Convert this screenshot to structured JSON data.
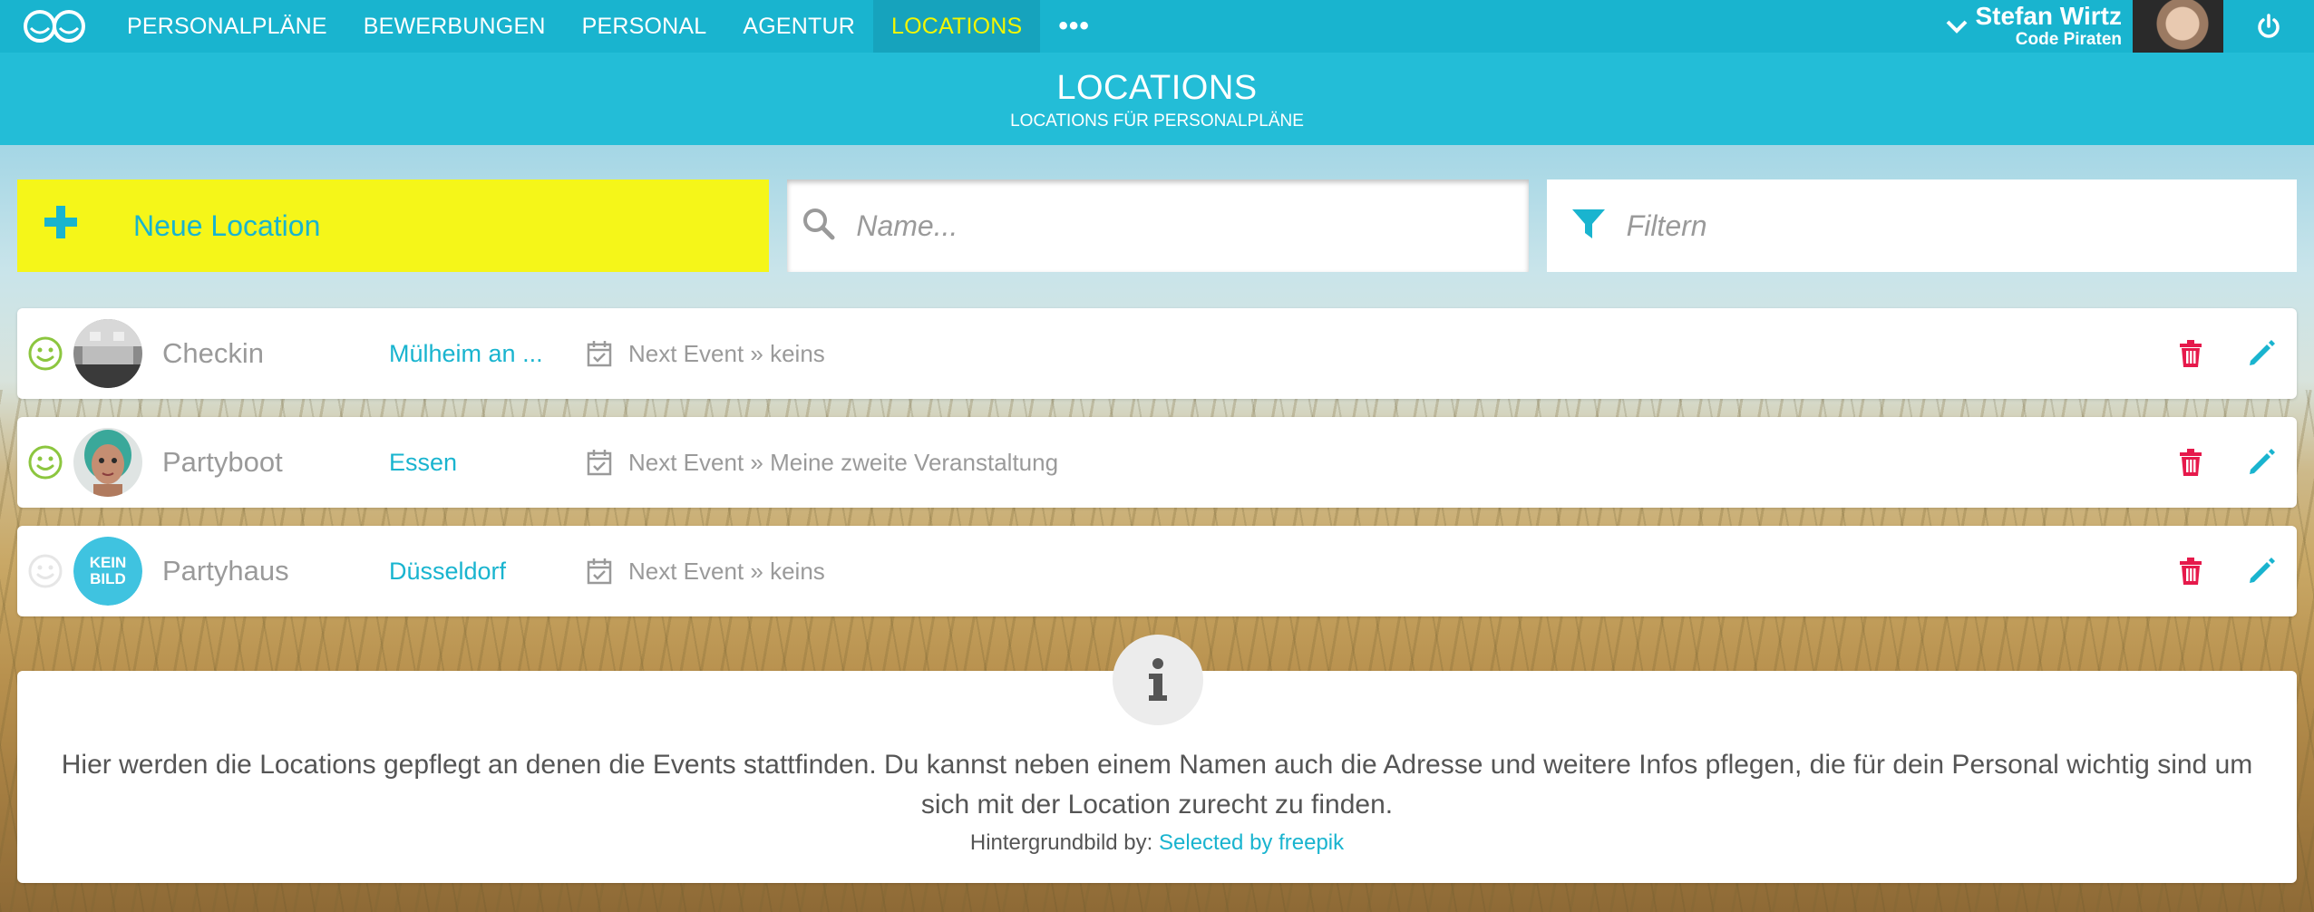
{
  "nav": {
    "items": [
      {
        "label": "PERSONALPLÄNE"
      },
      {
        "label": "BEWERBUNGEN"
      },
      {
        "label": "PERSONAL"
      },
      {
        "label": "AGENTUR"
      },
      {
        "label": "LOCATIONS"
      }
    ],
    "active": "LOCATIONS",
    "more_label": "•••"
  },
  "user": {
    "name": "Stefan Wirtz",
    "company": "Code Piraten"
  },
  "header": {
    "title": "LOCATIONS",
    "subtitle": "LOCATIONS FÜR PERSONALPLÄNE"
  },
  "toolbar": {
    "new_label": "Neue Location",
    "search_placeholder": "Name...",
    "filter_placeholder": "Filtern"
  },
  "locations": [
    {
      "name": "Checkin",
      "city": "Mülheim an ...",
      "next_event": "Next Event » keins",
      "active": true,
      "avatar": "photo-interior"
    },
    {
      "name": "Partyboot",
      "city": "Essen",
      "next_event": "Next Event » Meine zweite Veranstaltung",
      "active": true,
      "avatar": "photo-doll"
    },
    {
      "name": "Partyhaus",
      "city": "Düsseldorf",
      "next_event": "Next Event » keins",
      "active": false,
      "avatar": "kein-bild",
      "avatar_text_1": "KEIN",
      "avatar_text_2": "BILD"
    }
  ],
  "info": {
    "text": "Hier werden die Locations gepflegt an denen die Events stattfinden. Du kannst neben einem Namen auch die Adresse und weitere Infos pflegen, die für dein Personal wichtig sind um sich mit der Location zurecht zu finden.",
    "credit_label": "Hintergrundbild by:",
    "credit_link": "Selected by freepik"
  },
  "colors": {
    "primary": "#19b4cf",
    "highlight": "#f5f619",
    "active_nav_text": "#f3f600",
    "delete": "#e6194b",
    "smiley_active": "#8cc63f",
    "smiley_inactive": "#e6e6e6"
  }
}
